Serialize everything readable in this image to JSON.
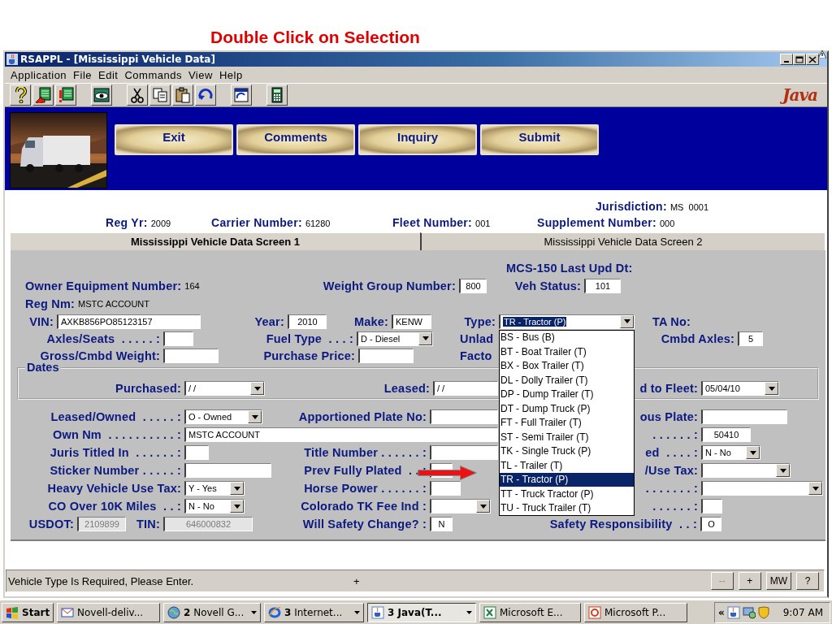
{
  "slide_title": "Double Click on Selection",
  "window": {
    "title": "RSAPPL - [Mississippi Vehicle Data]"
  },
  "menu": [
    "Application",
    "File",
    "Edit",
    "Commands",
    "View",
    "Help"
  ],
  "toolbar": {
    "logo": "Java"
  },
  "actions": [
    "Exit",
    "Comments",
    "Inquiry",
    "Submit"
  ],
  "header": {
    "jurisdiction": {
      "label": "Jurisdiction:",
      "value": "MS  0001"
    },
    "fields": [
      {
        "label": "Reg Yr:",
        "value": "2009"
      },
      {
        "label": "Carrier Number:",
        "value": "61280"
      },
      {
        "label": "Fleet Number:",
        "value": "001"
      },
      {
        "label": "Supplement Number:",
        "value": "000"
      }
    ]
  },
  "tabs": [
    {
      "label": "Mississippi Vehicle Data Screen 1",
      "selected": true
    },
    {
      "label": "Mississippi Vehicle Data Screen 2",
      "selected": false
    }
  ],
  "form": {
    "rows": [
      {
        "kind": "fields",
        "items": [
          {
            "kind": "label",
            "label": "MCS-150 Last Upd Dt:"
          }
        ]
      },
      {
        "kind": "fields",
        "items": [
          {
            "kind": "static",
            "label": "Owner Equipment Number:",
            "value": "164"
          },
          {
            "kind": "input",
            "label": "Weight Group Number:",
            "value": "800"
          },
          {
            "kind": "input",
            "label": "Veh Status:",
            "value": "101"
          }
        ]
      },
      {
        "kind": "fields",
        "items": [
          {
            "kind": "static",
            "label": "Reg Nm:",
            "value": "MSTC ACCOUNT"
          }
        ]
      },
      {
        "kind": "fields",
        "items": [
          {
            "kind": "input",
            "label": "VIN:",
            "value": "AXKB856PO85123157"
          },
          {
            "kind": "input",
            "label": "Year:",
            "value": "2010"
          },
          {
            "kind": "input",
            "label": "Make:",
            "value": "KENW"
          },
          {
            "kind": "combo",
            "label": "Type:",
            "value": "TR - Tractor (P)",
            "options": [
              {
                "label": "BS - Bus (B)",
                "selected": false
              },
              {
                "label": "BT - Boat Trailer (T)",
                "selected": false
              },
              {
                "label": "BX - Box Trailer (T)",
                "selected": false
              },
              {
                "label": "DL - Dolly Trailer (T)",
                "selected": false
              },
              {
                "label": "DP - Dump Trailer (T)",
                "selected": false
              },
              {
                "label": "DT - Dump Truck (P)",
                "selected": false
              },
              {
                "label": "FT - Full Trailer (T)",
                "selected": false
              },
              {
                "label": "ST - Semi Trailer (T)",
                "selected": false
              },
              {
                "label": "TK - Single Truck (P)",
                "selected": false
              },
              {
                "label": "TL - Trailer (T)",
                "selected": false
              },
              {
                "label": "TR - Tractor (P)",
                "selected": true
              },
              {
                "label": "TT - Truck Tractor (P)",
                "selected": false
              },
              {
                "label": "TU - Truck Trailer (T)",
                "selected": false
              }
            ]
          },
          {
            "kind": "label",
            "label": "TA No:"
          }
        ]
      },
      {
        "kind": "fields",
        "items": [
          {
            "kind": "input",
            "label": "Axles/Seats  . . . . . :"
          },
          {
            "kind": "select",
            "label": "Fuel Type  . . . :",
            "value": "D - Diesel"
          },
          {
            "kind": "label",
            "label": "Unlad"
          },
          {
            "kind": "input",
            "label": "Cmbd Axles:",
            "value": "5"
          }
        ]
      },
      {
        "kind": "fields",
        "items": [
          {
            "kind": "input",
            "label": "Gross/Cmbd Weight:"
          },
          {
            "kind": "input",
            "label": "Purchase Price:"
          },
          {
            "kind": "label",
            "label": "Facto"
          }
        ]
      },
      {
        "kind": "group",
        "title": "Dates",
        "items": [
          {
            "kind": "select",
            "label": "Purchased:",
            "value": "/ /"
          },
          {
            "kind": "input",
            "label": "Leased:",
            "value": "/ /"
          },
          {
            "kind": "select",
            "label": "d to Fleet:",
            "value": "05/04/10"
          }
        ]
      },
      {
        "kind": "fields",
        "items": [
          {
            "kind": "select",
            "label": "Leased/Owned  . . . . . :",
            "value": "O - Owned"
          },
          {
            "kind": "input",
            "label": "Apportioned Plate No:"
          },
          {
            "kind": "input",
            "label": "ous Plate:"
          }
        ]
      },
      {
        "kind": "fields",
        "items": [
          {
            "kind": "input",
            "label": "Own Nm  . . . . . . . . . . :",
            "value": "MSTC ACCOUNT"
          },
          {
            "kind": "input",
            "label": ". . . . . . :",
            "value": "50410"
          }
        ]
      },
      {
        "kind": "fields",
        "items": [
          {
            "kind": "input",
            "label": "Juris Titled In  . . . . . . :"
          },
          {
            "kind": "input",
            "label": "Title Number . . . . . . :"
          },
          {
            "kind": "select",
            "label": "ed  . . . . :",
            "value": "N - No"
          }
        ]
      },
      {
        "kind": "fields",
        "items": [
          {
            "kind": "input",
            "label": "Sticker Number . . . . . :"
          },
          {
            "kind": "input",
            "label": "Prev Fully Plated  . . :"
          },
          {
            "kind": "select",
            "label": "/Use Tax:"
          }
        ]
      },
      {
        "kind": "fields",
        "items": [
          {
            "kind": "select",
            "label": "Heavy Vehicle Use Tax:",
            "value": "Y - Yes"
          },
          {
            "kind": "input",
            "label": "Horse Power . . . . . . :"
          },
          {
            "kind": "select",
            "label": ". . . . . . . :"
          }
        ]
      },
      {
        "kind": "fields",
        "items": [
          {
            "kind": "select",
            "label": "CO Over 10K Miles  . . :",
            "value": "N - No"
          },
          {
            "kind": "select",
            "label": "Colorado TK Fee Ind :"
          },
          {
            "kind": "input",
            "label": ". . . . . . :"
          }
        ]
      },
      {
        "kind": "fields",
        "items": [
          {
            "kind": "readonly",
            "label": "USDOT:",
            "value": "2109899"
          },
          {
            "kind": "readonly",
            "label": "TIN:",
            "value": "646000832"
          },
          {
            "kind": "input",
            "label": "Will Safety Change? :",
            "value": "N"
          },
          {
            "kind": "input",
            "label": "Safety Responsibility  . . :",
            "value": "O"
          }
        ]
      }
    ]
  },
  "status_bar": {
    "message": "Vehicle Type Is Required, Please Enter.",
    "indicator": "+",
    "buttons": [
      "--",
      "+",
      "MW",
      "?"
    ]
  },
  "taskbar": {
    "start": "Start",
    "tasks": [
      {
        "label": "Novell-deliv...",
        "grouped": false,
        "selected": false
      },
      {
        "label": "**2** Novell G...",
        "grouped": true,
        "selected": false
      },
      {
        "label": "**3** Internet...",
        "grouped": true,
        "selected": false
      },
      {
        "label": "3 Java(T...",
        "grouped": true,
        "selected": true
      },
      {
        "label": "Microsoft E...",
        "grouped": false,
        "selected": false
      },
      {
        "label": "Microsoft P...",
        "grouped": false,
        "selected": false
      }
    ],
    "tray_toggle": "«",
    "clock": "9:07 AM"
  }
}
